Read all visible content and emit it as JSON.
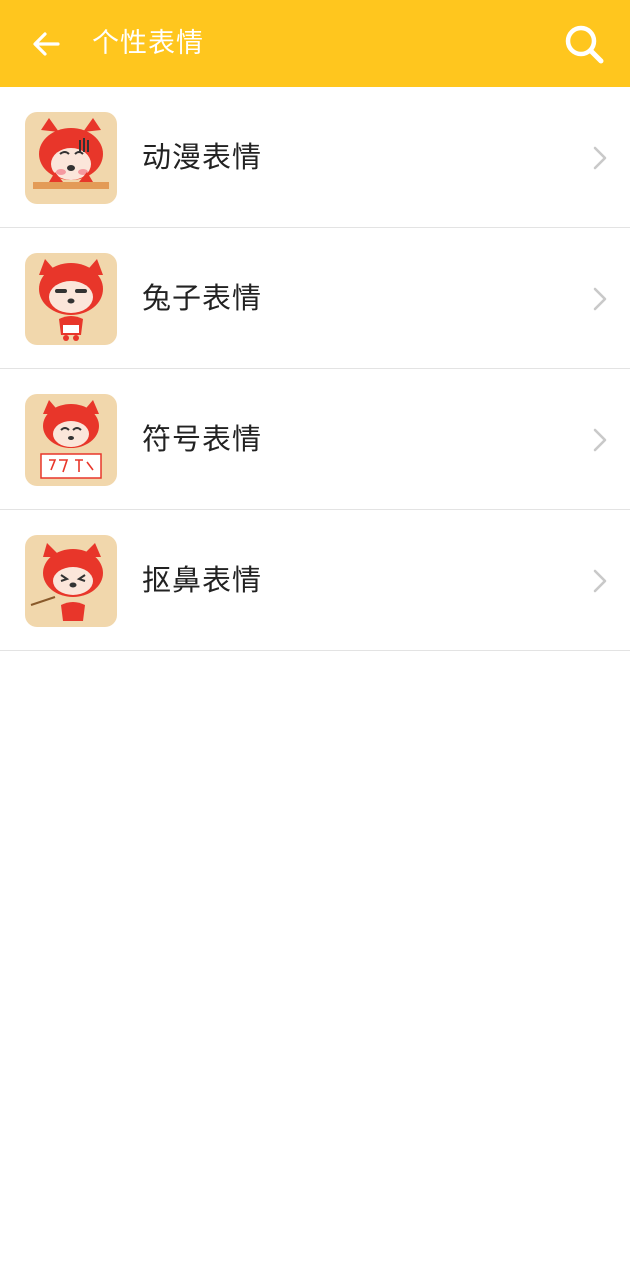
{
  "header": {
    "title": "个性表情",
    "back_icon": "arrow-left-icon",
    "search_icon": "search-icon",
    "background_color": "#FFC61E"
  },
  "list": {
    "items": [
      {
        "label": "动漫表情",
        "icon": "fox-crying-sticker"
      },
      {
        "label": "兔子表情",
        "icon": "fox-sleepy-sticker"
      },
      {
        "label": "符号表情",
        "icon": "fox-sign-sticker"
      },
      {
        "label": "抠鼻表情",
        "icon": "fox-picking-nose-sticker"
      }
    ],
    "chevron_icon": "chevron-right-icon"
  },
  "colors": {
    "accent": "#FFC61E",
    "thumb_bg": "#F1D7AC",
    "fox_red": "#E8362A",
    "divider": "#E3E3E3"
  }
}
